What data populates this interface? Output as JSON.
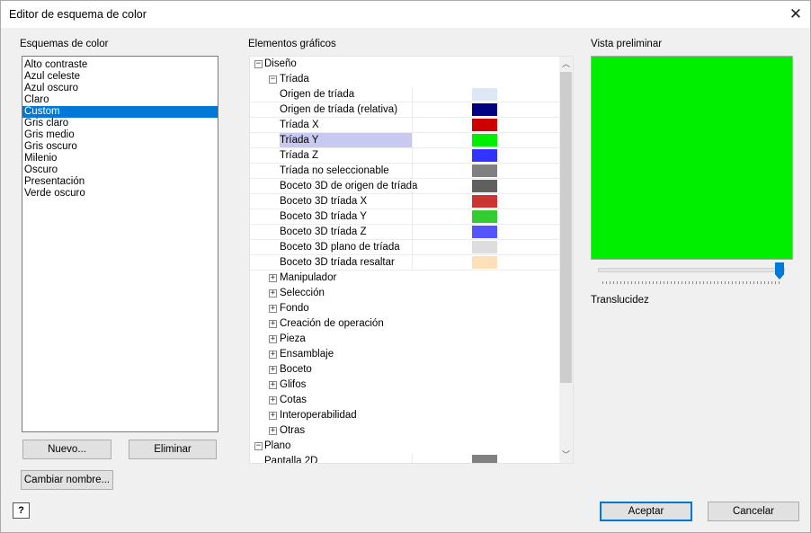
{
  "window": {
    "title": "Editor de esquema de color"
  },
  "schemes": {
    "label": "Esquemas de color",
    "items": [
      "Alto contraste",
      "Azul celeste",
      "Azul oscuro",
      "Claro",
      "Custom",
      "Gris claro",
      "Gris medio",
      "Gris oscuro",
      "Milenio",
      "Oscuro",
      "Presentación",
      "Verde oscuro"
    ],
    "selected": "Custom"
  },
  "tree": {
    "label": "Elementos gráficos",
    "root1": "Diseño",
    "triad": "Tríada",
    "leaves": [
      {
        "name": "Origen de tríada",
        "color": "#dce8f6"
      },
      {
        "name": "Origen de tríada (relativa)",
        "color": "#000080"
      },
      {
        "name": "Tríada X",
        "color": "#cc0000"
      },
      {
        "name": "Tríada Y",
        "color": "#00ee00"
      },
      {
        "name": "Tríada Z",
        "color": "#3333ff"
      },
      {
        "name": "Tríada no seleccionable",
        "color": "#808080"
      },
      {
        "name": "Boceto 3D de origen de tríada",
        "color": "#606060"
      },
      {
        "name": "Boceto 3D tríada X",
        "color": "#cc3333"
      },
      {
        "name": "Boceto 3D tríada Y",
        "color": "#33cc33"
      },
      {
        "name": "Boceto 3D tríada Z",
        "color": "#5555ff"
      },
      {
        "name": "Boceto 3D plano de tríada",
        "color": "#dddddd"
      },
      {
        "name": "Boceto 3D tríada resaltar",
        "color": "#fde0b8"
      }
    ],
    "groups": [
      "Manipulador",
      "Selección",
      "Fondo",
      "Creación de operación",
      "Pieza",
      "Ensamblaje",
      "Boceto",
      "Glifos",
      "Cotas",
      "Interoperabilidad",
      "Otras"
    ],
    "root2": "Plano",
    "bottom_item": {
      "name": "Pantalla 2D",
      "color": "#808080"
    }
  },
  "preview": {
    "label": "Vista preliminar",
    "color": "#00ee00"
  },
  "translucency": {
    "label": "Translucidez",
    "value_fraction": 1.0
  },
  "buttons": {
    "new": "Nuevo...",
    "delete": "Eliminar",
    "rename": "Cambiar nombre...",
    "accept": "Aceptar",
    "cancel": "Cancelar",
    "help": "?"
  },
  "colors": {
    "accent": "#0078d7",
    "selected_row": "#c8c8f0"
  }
}
